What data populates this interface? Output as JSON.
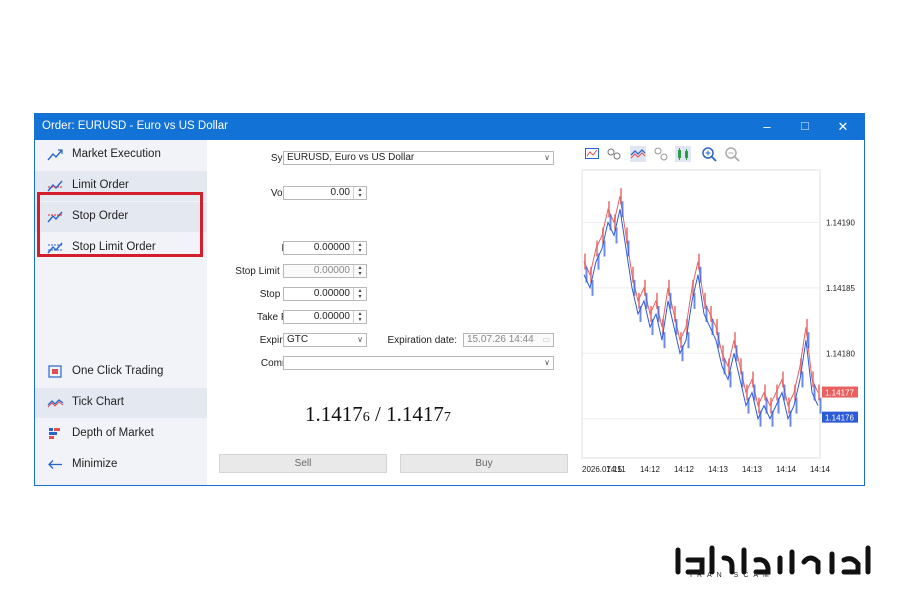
{
  "window": {
    "title": "Order: EURUSD - Euro vs US Dollar",
    "minimize_glyph": "–",
    "maximize_glyph": "☐",
    "close_glyph": "✕"
  },
  "sidebar": {
    "items": [
      {
        "label": "Market Execution",
        "icon": "market-execution-icon"
      },
      {
        "label": "Limit Order",
        "icon": "limit-order-icon"
      },
      {
        "label": "Stop Order",
        "icon": "stop-order-icon"
      },
      {
        "label": "Stop Limit Order",
        "icon": "stop-limit-order-icon"
      },
      {
        "label": "One Click Trading",
        "icon": "one-click-trading-icon"
      },
      {
        "label": "Tick Chart",
        "icon": "tick-chart-icon"
      },
      {
        "label": "Depth of Market",
        "icon": "depth-of-market-icon"
      },
      {
        "label": "Minimize",
        "icon": "arrow-left-icon"
      }
    ]
  },
  "form": {
    "symbol_label": "Symbol:",
    "symbol_value": "EURUSD, Euro vs US Dollar",
    "volume_label": "Volume:",
    "volume_value": "0.00",
    "price_label": "Price:",
    "price_value": "0.00000",
    "stop_limit_label": "Stop Limit price:",
    "stop_limit_value": "0.00000",
    "stop_loss_label": "Stop Loss:",
    "stop_loss_value": "0.00000",
    "take_profit_label": "Take Profit:",
    "take_profit_value": "0.00000",
    "expiration_label": "Expiration:",
    "expiration_value": "GTC",
    "expiration_date_label": "Expiration date:",
    "expiration_date_value": "15.07.26 14:44",
    "comment_label": "Comment:",
    "comment_value": "",
    "bid_main": "1.1417",
    "bid_small": "6",
    "separator": "/",
    "ask_main": "1.1417",
    "ask_small": "7",
    "sell_label": "Sell",
    "buy_label": "Buy"
  },
  "colors": {
    "titlebar": "#1372d6",
    "highlight_box": "#d21f2b",
    "ask_line": "#e86060",
    "bid_line": "#2d5bd8"
  },
  "chart_data": {
    "type": "line",
    "x_tick_labels": [
      "2026.07.15",
      "14:11",
      "14:12",
      "14:12",
      "14:13",
      "14:13",
      "14:14",
      "14:14"
    ],
    "y_tick_labels": [
      "1.14190",
      "1.14185",
      "1.14180",
      "1.14175"
    ],
    "ylim": [
      1.14172,
      1.14194
    ],
    "ask_label": "1.14177",
    "bid_label": "1.14176",
    "series": [
      {
        "name": "",
        "color": "#e86060",
        "values": [
          1.14187,
          1.14186,
          1.14188,
          1.14189,
          1.14191,
          1.1419,
          1.14192,
          1.14189,
          1.14186,
          1.14184,
          1.14185,
          1.14183,
          1.14184,
          1.14182,
          1.14185,
          1.14183,
          1.14181,
          1.14182,
          1.14185,
          1.14187,
          1.14184,
          1.14183,
          1.14182,
          1.1418,
          1.14179,
          1.14181,
          1.14179,
          1.14177,
          1.14178,
          1.14176,
          1.14177,
          1.14176,
          1.14177,
          1.14178,
          1.14176,
          1.14177,
          1.14179,
          1.14182,
          1.14178,
          1.14177
        ]
      },
      {
        "name": "",
        "color": "#2d5bd8",
        "values": [
          1.14186,
          1.14185,
          1.14187,
          1.14188,
          1.1419,
          1.14189,
          1.14191,
          1.14188,
          1.14185,
          1.14183,
          1.14184,
          1.14182,
          1.14183,
          1.14181,
          1.14184,
          1.14182,
          1.1418,
          1.14181,
          1.14184,
          1.14186,
          1.14183,
          1.14182,
          1.14181,
          1.14179,
          1.14178,
          1.1418,
          1.14178,
          1.14176,
          1.14177,
          1.14175,
          1.14176,
          1.14175,
          1.14176,
          1.14177,
          1.14175,
          1.14176,
          1.14178,
          1.14181,
          1.14177,
          1.14176
        ]
      }
    ]
  },
  "brand": {
    "name": "ایران اسکم",
    "sub": "IRAN SCAM"
  }
}
